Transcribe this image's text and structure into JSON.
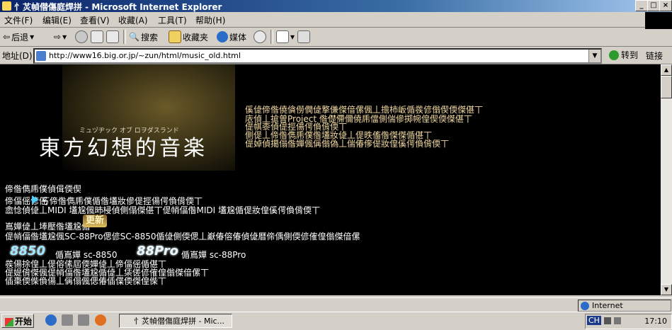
{
  "window": {
    "title": "忄炗幀僣傷庭焊拼 - Microsoft Internet Explorer",
    "controls": {
      "minimize": "_",
      "maximize": "□",
      "close": "×"
    }
  },
  "menu": [
    "文件(F)",
    "编辑(E)",
    "查看(V)",
    "收藏(A)",
    "工具(T)",
    "帮助(H)"
  ],
  "toolbar": {
    "back": "后退",
    "search": "搜索",
    "favorites": "收藏夹",
    "media": "媒体"
  },
  "address": {
    "label": "地址(D)",
    "url": "http://www16.big.or.jp/~zun/html/music_old.html",
    "go": "转到",
    "links": "链接"
  },
  "page": {
    "banner_sub": "ミュヅヂック オブ ロヲダスランド",
    "banner_title": "東方幻想的音楽",
    "intro": [
      "傒偼偙偺僥僋僗僩偼撉傔傑偣傫偑丄擔杮岅偱彂偐傟偰偄傑偡丅",
      "庡偵丄搶曽Project 偺儊僀儞僥乕儅側偳傪掷帵偟偰偄傑偡丅",
      "偍帺桼偵偍挳偒偔偩偝偄丅",
      "側偍丄偙偺儁乕僕偺壒妝偼丄偍昳傗偺傑傑偱偡丅",
      "偍婥偵擖傝偺嬋偑偁傟偽丄偳偆偧偍妝偟傒偔偩偝偄丅"
    ],
    "section_head": "偙偺儁乕僕偵偮偄偰",
    "line1": "偙偪傜偐傜",
    "line1b": "丂偙偺儁乕僕偱偺壒妝傪偍挳偒偔偩偝偄丅",
    "line2": "嵞惗偵偼丄MIDI 壒尮偑昁梫偵側傝傑偡丅偍帩偪偺MIDI 壒尮偱偍妝偟傒偔偩偝偄丅",
    "new_badge": "更新",
    "line3": "嶌嬋偼丄埲壓偺壒尮偱",
    "line3b": "偍帩偪偺壒尮偑SC-88Pro偲偐SC-8850偱偼側偄偲丄巚偆傛偆偵偼暦偙偊側偄偐傕偟傟傑偣傫",
    "logo1": "8850",
    "logo1_label": "偱嶌嬋 sc-8850",
    "logo2": "88Pro",
    "logo2_label": "偱嶌嬋 sc-88Pro",
    "line4": "彂偒捈偟丄偍傛傃屆偄嬋偼丄偙偪傜偱偡丅",
    "line5": "偍媞偝傑偑偍帩偪偺壒尮偱偼丄栠傞偐傕偟傟傑偣傫丅",
    "line6": "偛棗偄偨偩偒丄偁傝偑偲偆偛偞偄傑偟偨丅"
  },
  "status": {
    "zone": "Internet"
  },
  "taskbar": {
    "start": "开始",
    "task": "忄炗幀僣傷庭焊拼 - Mic...",
    "ime": "CH",
    "clock": "17:10"
  }
}
